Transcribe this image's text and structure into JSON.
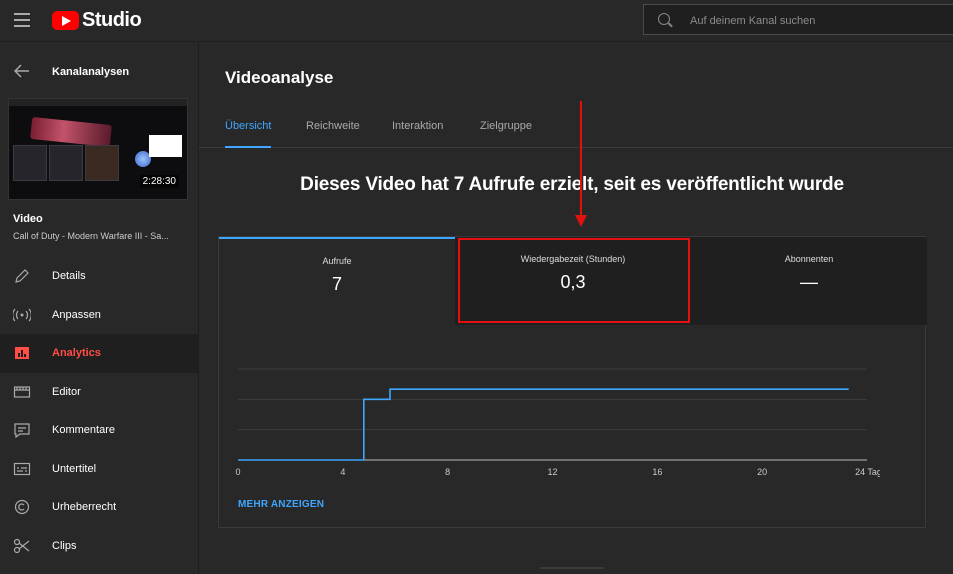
{
  "header": {
    "logo_text": "Studio",
    "search_placeholder": "Auf deinem Kanal suchen"
  },
  "sidebar": {
    "back_label": "Kanalanalysen",
    "thumbnail_duration": "2:28:30",
    "video_heading": "Video",
    "video_title": "Call of Duty - Modern Warfare III - Sa...",
    "items": [
      {
        "label": "Details",
        "icon": "pencil-icon"
      },
      {
        "label": "Anpassen",
        "icon": "broadcast-icon"
      },
      {
        "label": "Analytics",
        "icon": "analytics-icon",
        "active": true
      },
      {
        "label": "Editor",
        "icon": "film-icon"
      },
      {
        "label": "Kommentare",
        "icon": "comment-icon"
      },
      {
        "label": "Untertitel",
        "icon": "subtitles-icon"
      },
      {
        "label": "Urheberrecht",
        "icon": "copyright-icon"
      },
      {
        "label": "Clips",
        "icon": "scissors-icon"
      }
    ]
  },
  "main": {
    "title": "Videoanalyse",
    "tabs": [
      {
        "label": "Übersicht",
        "active": true
      },
      {
        "label": "Reichweite"
      },
      {
        "label": "Interaktion"
      },
      {
        "label": "Zielgruppe"
      }
    ],
    "headline": "Dieses Video hat 7 Aufrufe erzielt, seit es veröffentlicht wurde",
    "metrics": [
      {
        "label": "Aufrufe",
        "value": "7",
        "selected": true
      },
      {
        "label": "Wiedergabezeit (Stunden)",
        "value": "0,3",
        "highlighted": true
      },
      {
        "label": "Abonnenten",
        "value": "—"
      }
    ],
    "more_label": "MEHR ANZEIGEN"
  },
  "colors": {
    "accent": "#3ea6ff",
    "highlight": "#e41010",
    "brand_red": "#ff0000",
    "line": "#3ea6ff"
  },
  "chart_data": {
    "type": "line",
    "series": [
      {
        "x": [
          0,
          4.8,
          4.8,
          5.8,
          5.8,
          23.3
        ],
        "y": [
          0,
          0,
          6,
          6,
          7,
          7
        ]
      }
    ],
    "xticks": [
      "0",
      "4",
      "8",
      "12",
      "16",
      "20",
      "24 Tage"
    ],
    "yticks": [
      "0",
      "3",
      "6",
      "9"
    ],
    "xlim": [
      0,
      24
    ],
    "ylim": [
      0,
      9
    ],
    "grid": true
  }
}
